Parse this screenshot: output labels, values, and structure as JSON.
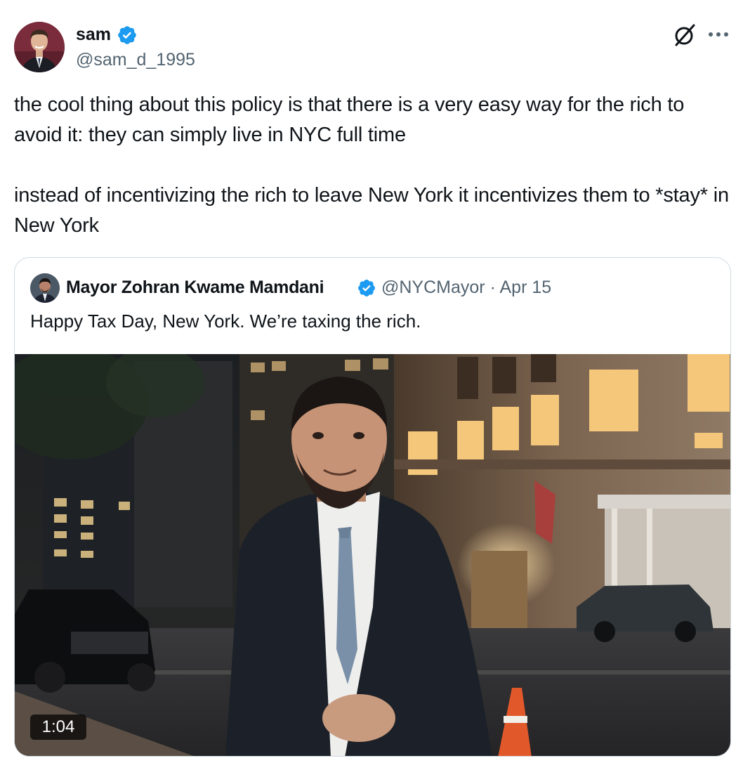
{
  "tweet": {
    "author_name": "sam",
    "author_handle": "@sam_d_1995",
    "verified": true,
    "text_lines": [
      "the cool thing about this policy is that there is a very easy way for the rich to avoid it: they can simply live in NYC full time",
      "instead of incentivizing the rich to leave New York it incentivizes them to *stay* in New York"
    ]
  },
  "icons": {
    "verified": "verified-badge-icon",
    "grok": "grok-icon",
    "more": "more-options-icon"
  },
  "quote": {
    "author_name": "Mayor Zohran Kwame Mamdani",
    "author_handle": "@NYCMayor",
    "date": "Apr 15",
    "verified": true,
    "text": "Happy Tax Day, New York. We’re taxing the rich.",
    "video_duration": "1:04"
  },
  "colors": {
    "verified_blue": "#1d9bf0",
    "secondary_text": "#536471",
    "border": "#cfd9de"
  }
}
